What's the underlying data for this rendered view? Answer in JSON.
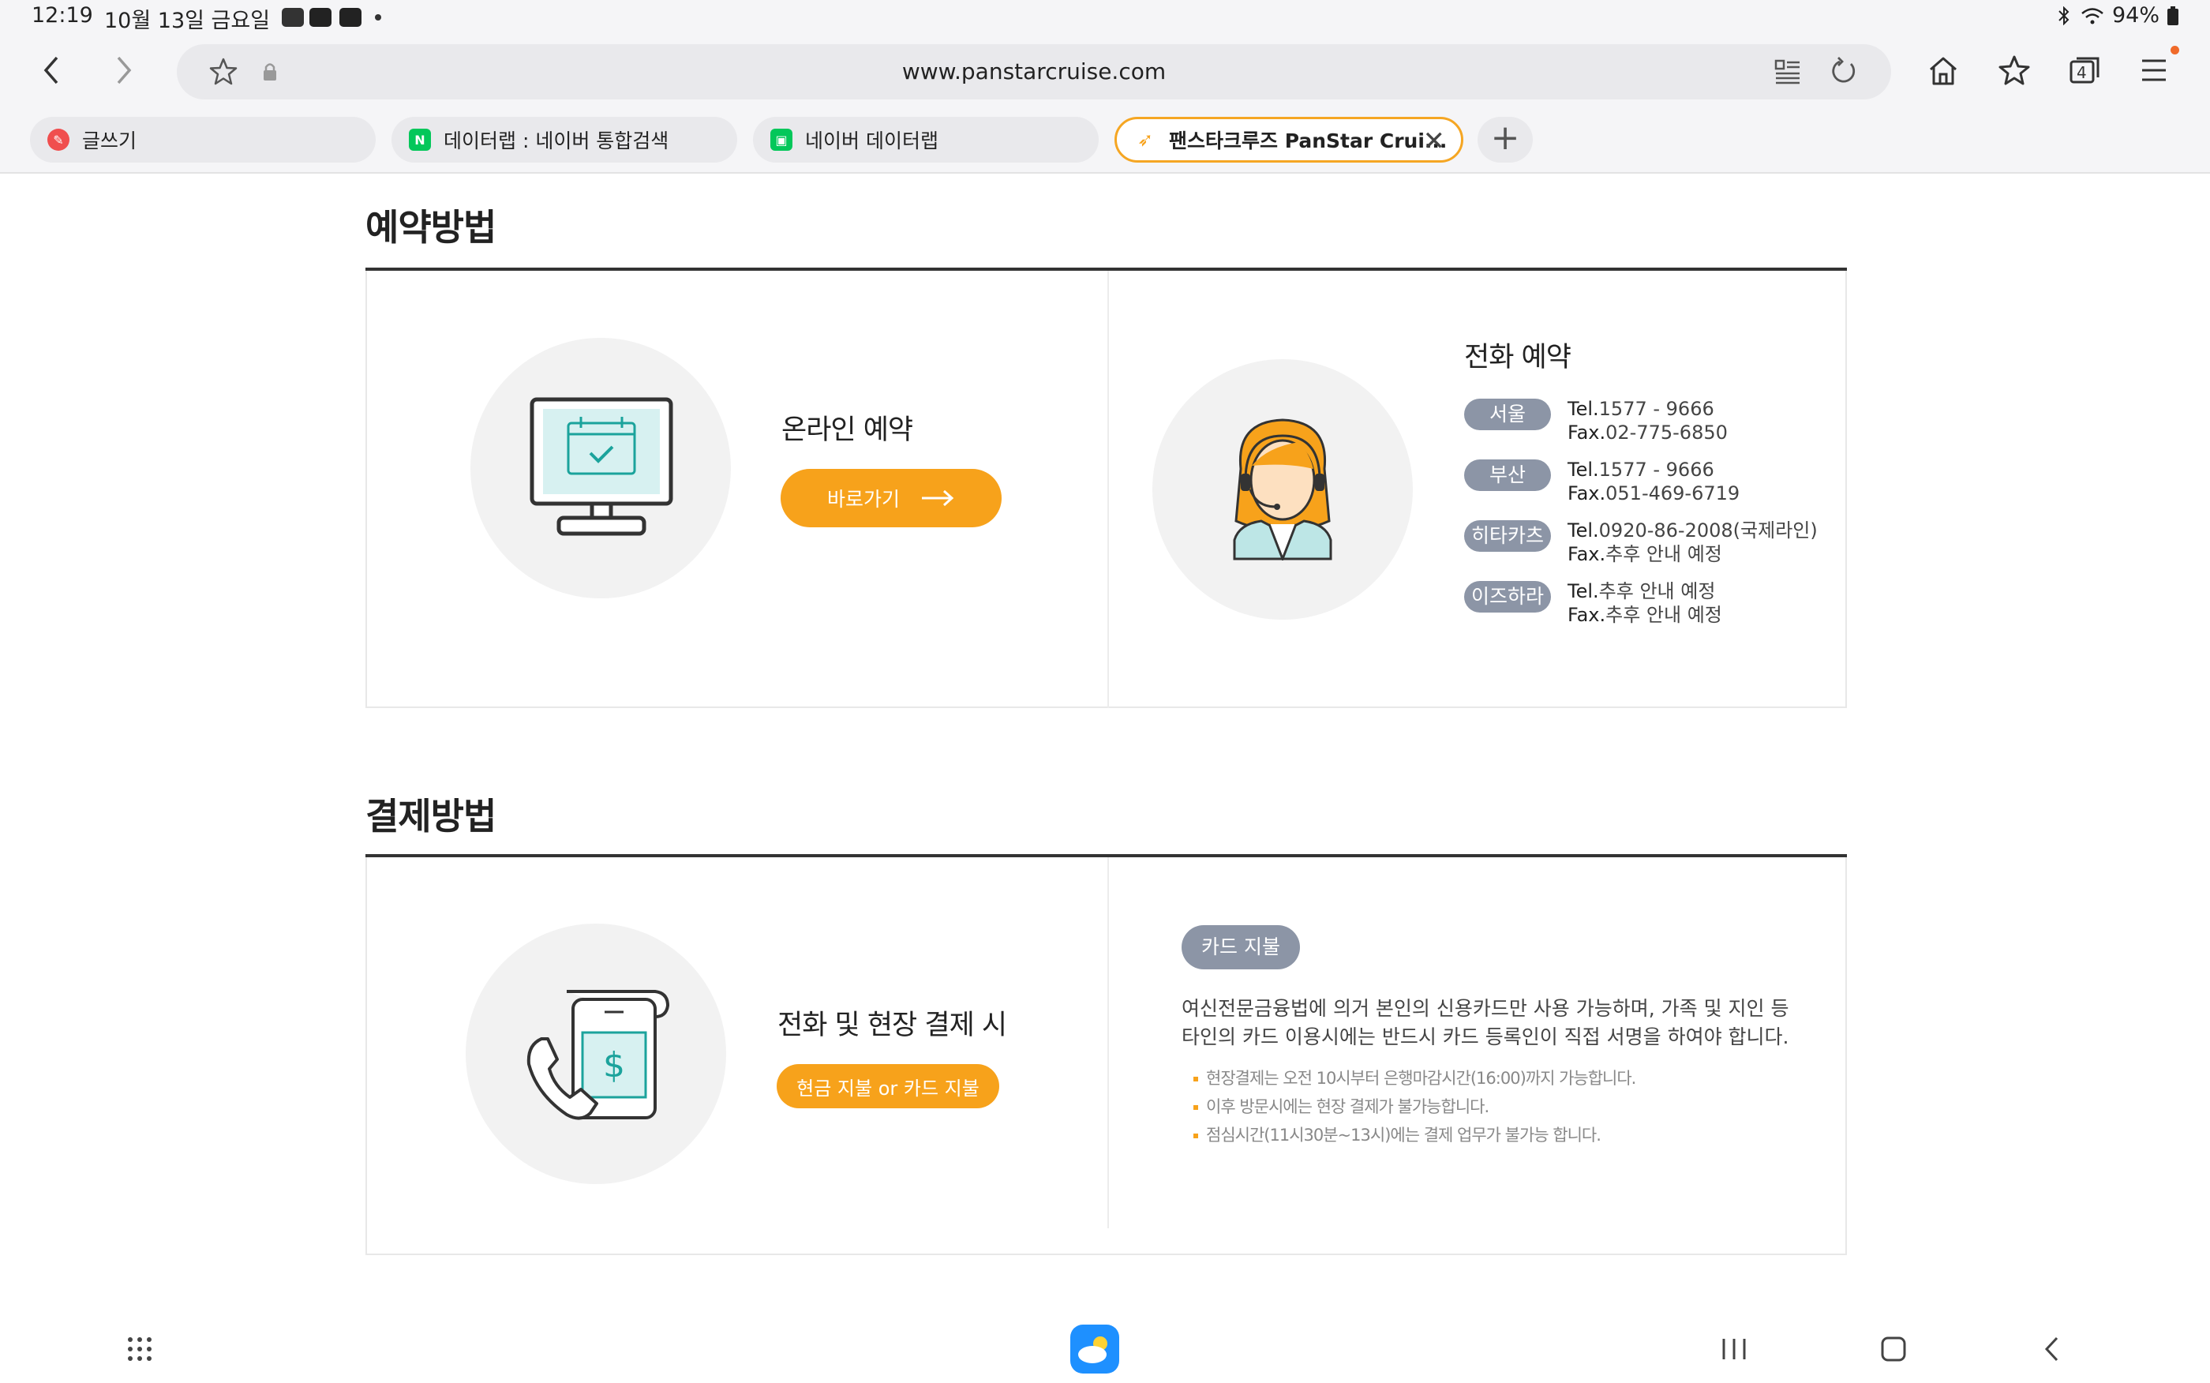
{
  "status_bar": {
    "time": "12:19",
    "date": "10월 13일 금요일",
    "battery": "94%"
  },
  "browser": {
    "url": "www.panstarcruise.com",
    "tabs": [
      {
        "label": "글쓰기",
        "icon": "pen-app-icon",
        "icon_color": "#f04e4e"
      },
      {
        "label": "데이터랩 : 네이버 통합검색",
        "icon": "naver-n-icon",
        "icon_color": "#03c75a"
      },
      {
        "label": "네이버 데이터랩",
        "icon": "datalab-icon",
        "icon_color": "#03c75a"
      },
      {
        "label": "팬스타크루즈 PanStar Crui...",
        "icon": "panstar-icon",
        "icon_color": "#f7a21b",
        "active": true
      }
    ],
    "tab_count": "4"
  },
  "reservation": {
    "title": "예약방법",
    "online": {
      "heading": "온라인 예약",
      "button": "바로가기"
    },
    "phone": {
      "heading": "전화 예약",
      "branches": [
        {
          "name": "서울",
          "tel_prefix": "Tel.",
          "tel": "1577 - 9666",
          "fax_prefix": "Fax.",
          "fax": "02-775-6850"
        },
        {
          "name": "부산",
          "tel_prefix": "Tel.",
          "tel": "1577 - 9666",
          "fax_prefix": "Fax.",
          "fax": "051-469-6719"
        },
        {
          "name": "히타카츠",
          "tel_prefix": "Tel.",
          "tel": "0920-86-2008(국제라인)",
          "fax_prefix": "Fax.",
          "fax": "추후 안내 예정"
        },
        {
          "name": "이즈하라",
          "tel_prefix": "Tel.",
          "tel": "추후 안내 예정",
          "fax_prefix": "Fax.",
          "fax": "추후 안내 예정"
        }
      ]
    }
  },
  "payment": {
    "title": "결제방법",
    "left": {
      "heading": "전화 및 현장 결제 시",
      "badge": "현금 지불 or 카드 지불"
    },
    "right": {
      "badge": "카드 지불",
      "desc_line1": "여신전문금융법에 의거 본인의 신용카드만 사용 가능하며, 가족 및 지인 등",
      "desc_line2": "타인의 카드 이용시에는 반드시 카드 등록인이 직접 서명을 하여야 합니다.",
      "notes": [
        "현장결제는 오전 10시부터 은행마감시간(16:00)까지 가능합니다.",
        "이후 방문시에는 현장 결제가 불가능합니다.",
        "점심시간(11시30분~13시)에는 결제 업무가 불가능 합니다."
      ]
    }
  },
  "colors": {
    "accent": "#f7a21b",
    "pill_gray": "#8c95a6",
    "chrome": "#f5f5f7"
  }
}
